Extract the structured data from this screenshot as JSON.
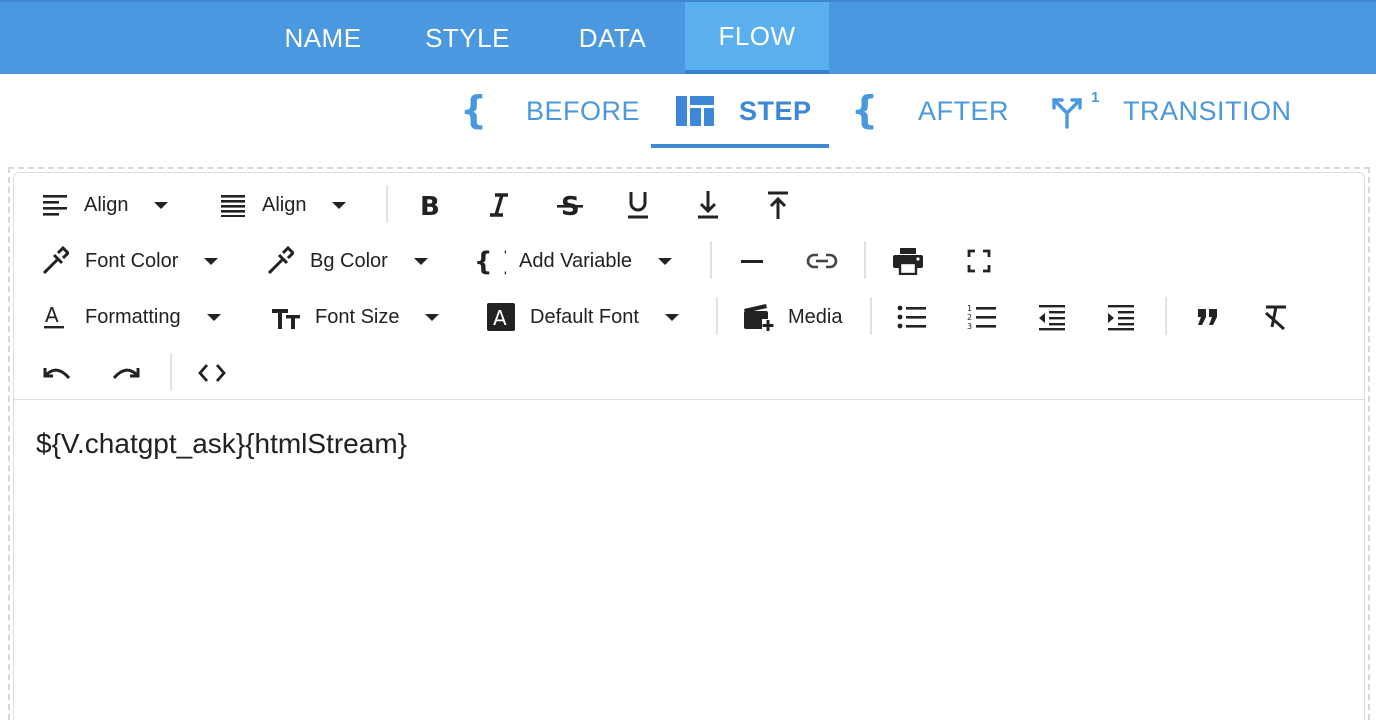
{
  "top_tabs": [
    {
      "label": "NAME"
    },
    {
      "label": "STYLE"
    },
    {
      "label": "DATA"
    },
    {
      "label": "FLOW",
      "active": true
    }
  ],
  "sub_tabs": {
    "before": {
      "label": "BEFORE",
      "icon": "braces-icon"
    },
    "step": {
      "label": "STEP",
      "icon": "layout-icon",
      "active": true
    },
    "after": {
      "label": "AFTER",
      "icon": "braces-icon"
    },
    "transition": {
      "label": "TRANSITION",
      "icon": "fork-icon",
      "badge": "1"
    }
  },
  "toolbar": {
    "align1": "Align",
    "align2": "Align",
    "font_color": "Font Color",
    "bg_color": "Bg Color",
    "add_variable": "Add Variable",
    "formatting": "Formatting",
    "font_size": "Font Size",
    "default_font": "Default Font",
    "media": "Media"
  },
  "editor": {
    "content": "${V.chatgpt_ask}{htmlStream}"
  },
  "colors": {
    "primary": "#4a98e0",
    "active_tab": "#5ab0ee",
    "text": "#212121"
  }
}
